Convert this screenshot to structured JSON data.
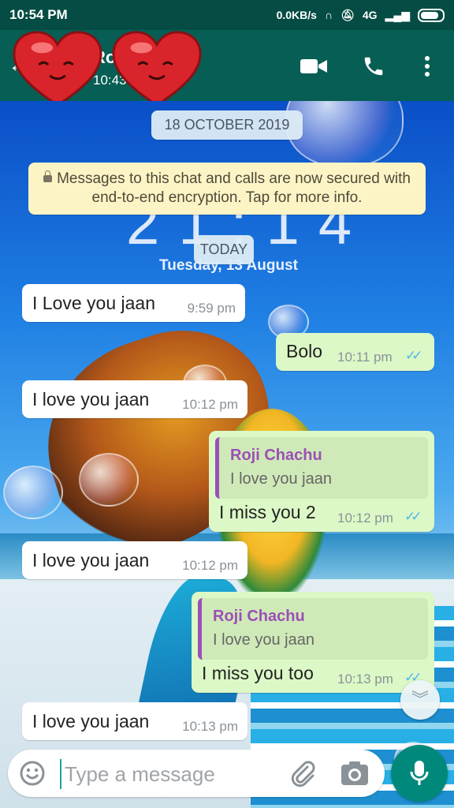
{
  "status_bar": {
    "time": "10:54 PM",
    "net_speed": "0.0KB/s",
    "network": "4G"
  },
  "header": {
    "contact_name": "Roji Chachu",
    "contact_status": "10:43",
    "video_call_icon": "video-camera-icon",
    "voice_call_icon": "phone-icon",
    "menu_icon": "more-vert-icon"
  },
  "wallpaper": {
    "clock_digits": "21:14",
    "clock_date": "Tuesday, 13 August"
  },
  "chat": {
    "date_chip_1": "18 OCTOBER 2019",
    "encryption_notice": "Messages to this chat and calls are now secured with end-to-end encryption. Tap for more info.",
    "date_chip_2": "TODAY",
    "messages": [
      {
        "direction": "in",
        "text": "I Love you jaan",
        "time": "9:59 pm"
      },
      {
        "direction": "out",
        "text": "Bolo",
        "time": "10:11 pm",
        "status": "read"
      },
      {
        "direction": "in",
        "text": "I love you jaan",
        "time": "10:12 pm"
      },
      {
        "direction": "out",
        "quote_author": "Roji Chachu",
        "quote_text": "I love you jaan",
        "text": "I miss you 2",
        "time": "10:12 pm",
        "status": "read"
      },
      {
        "direction": "in",
        "text": "I love you jaan",
        "time": "10:12 pm"
      },
      {
        "direction": "out",
        "quote_author": "Roji Chachu",
        "quote_text": "I love you jaan",
        "text": "I miss you too",
        "time": "10:13 pm",
        "status": "read"
      },
      {
        "direction": "in",
        "text": "I love you jaan",
        "time": "10:13 pm"
      }
    ]
  },
  "composer": {
    "placeholder": "Type a message",
    "emoji_icon": "emoji-icon",
    "attach_icon": "paperclip-icon",
    "camera_icon": "camera-icon",
    "mic_icon": "mic-icon"
  },
  "colors": {
    "header": "#075e54",
    "status_bar": "#054d44",
    "incoming_bubble": "#ffffff",
    "outgoing_bubble": "#dcf8c6",
    "read_ticks": "#4fb6ec",
    "quote_accent": "#9c4fb5",
    "mic_button": "#00897b"
  }
}
